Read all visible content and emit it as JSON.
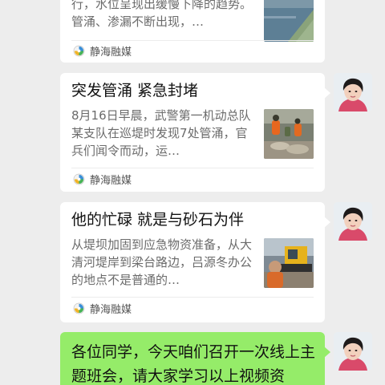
{
  "colors": {
    "background": "#ededed",
    "card": "#ffffff",
    "bubble": "#95ec69",
    "desc_text": "#6b6b6b"
  },
  "messages": [
    {
      "title": "",
      "description": "行，水位呈现出缓慢下降的趋势。管涌、渗漏不断出现，…",
      "source": "静海融媒",
      "source_icon": "source-logo-icon",
      "thumbnail": "river-embankment-image"
    },
    {
      "title": "突发管涌 紧急封堵",
      "description": "8月16日早晨，武警第一机动总队某支队在巡堤时发现7处管涌，官兵们闻令而动，运…",
      "source": "静海融媒",
      "source_icon": "source-logo-icon",
      "thumbnail": "soldiers-sandbags-image"
    },
    {
      "title": "他的忙碌 就是与砂石为伴",
      "description": "从堤坝加固到应急物资准备，从大清河堤岸到梁台路边，吕源冬办公的地点不是普通的…",
      "source": "静海融媒",
      "source_icon": "source-logo-icon",
      "thumbnail": "excavator-worker-image"
    }
  ],
  "text_message": "各位同学，今天咱们召开一次线上主题班会，请大家学习以上视频资"
}
